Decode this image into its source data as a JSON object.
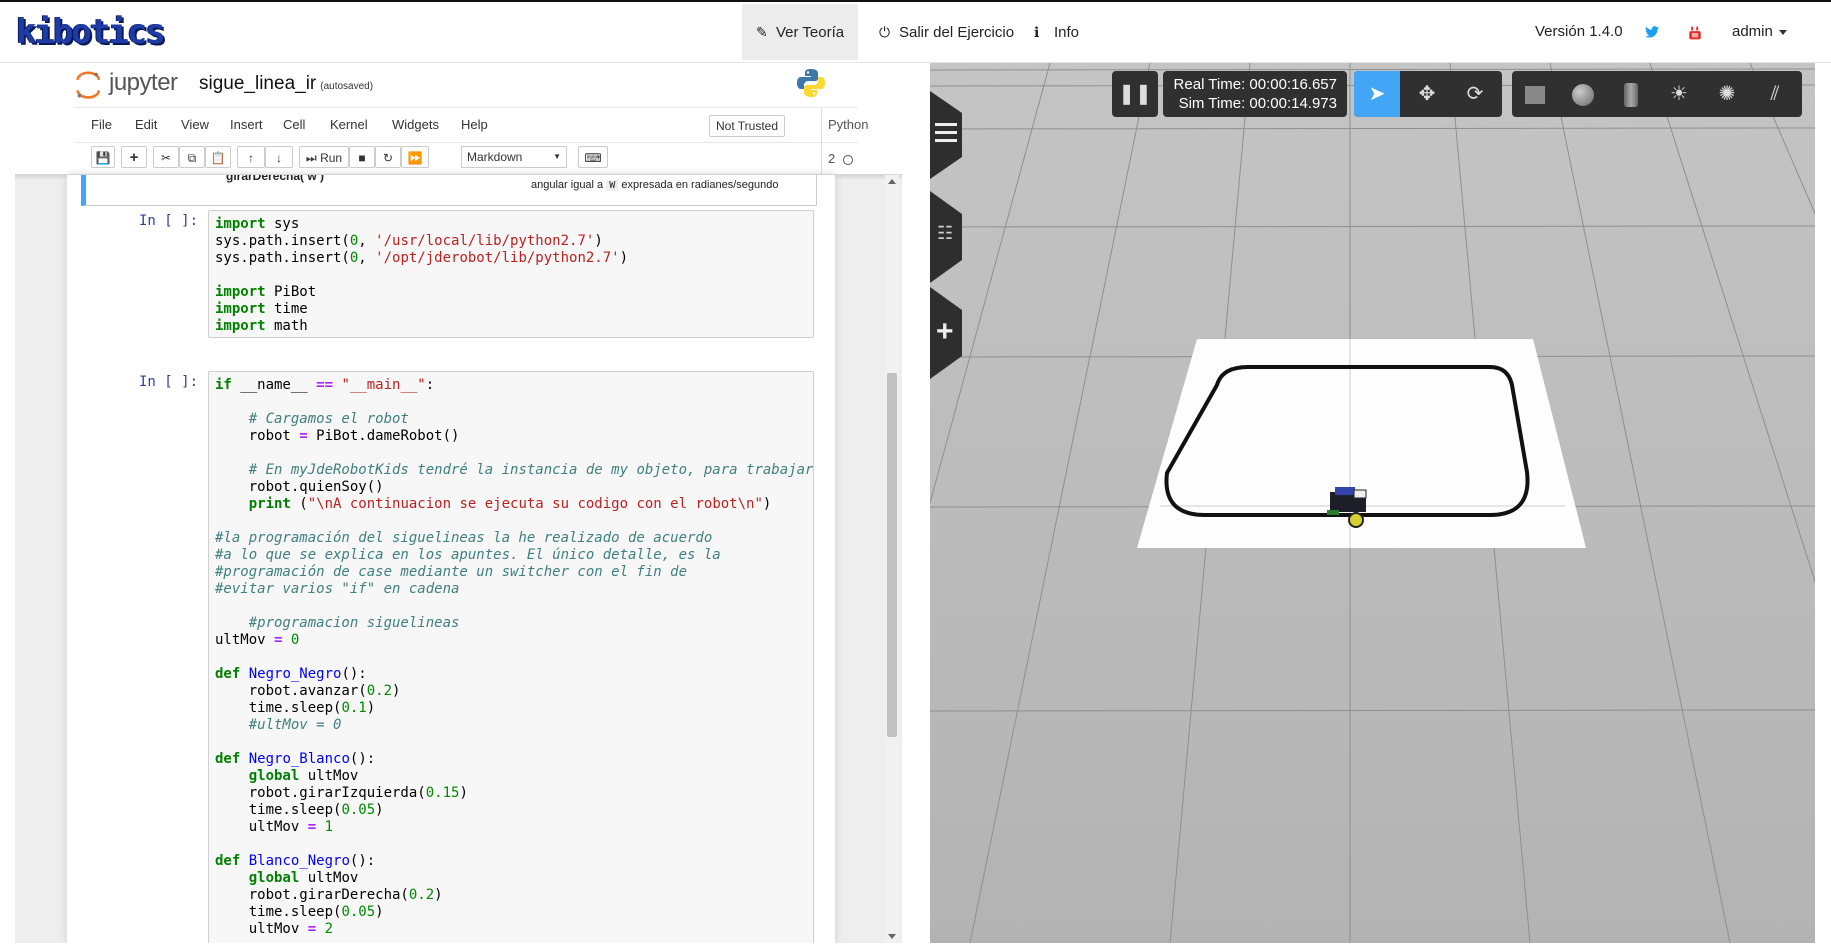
{
  "navbar": {
    "logo_text": "kibotics",
    "ver_teoria": "Ver Teoría",
    "salir": "Salir del Ejercicio",
    "info": "Info",
    "version": "Versión 1.4.0",
    "user": "admin"
  },
  "jupyter": {
    "brand": "jupyter",
    "notebook_name": "sigue_linea_ir",
    "autosaved": "(autosaved)",
    "menu": [
      "File",
      "Edit",
      "View",
      "Insert",
      "Cell",
      "Kernel",
      "Widgets",
      "Help"
    ],
    "trust": "Not Trusted",
    "kernel": "Python 2",
    "run_label": "Run",
    "cell_type": "Markdown",
    "md_left": "girarDerecha( w )",
    "md_right_pre": "angular igual a",
    "md_right_code": "W",
    "md_right_post": "expresada en radianes/segundo",
    "prompt": "In [ ]:"
  },
  "simulator": {
    "real_time": "Real Time: 00:00:16.657",
    "sim_time": "Sim Time: 00:00:14.973"
  },
  "colors": {
    "accent": "#42a5f5",
    "sim_toolbar": "#303030",
    "active_tool": "#42a5f5",
    "floor": "#b9b9b9"
  }
}
